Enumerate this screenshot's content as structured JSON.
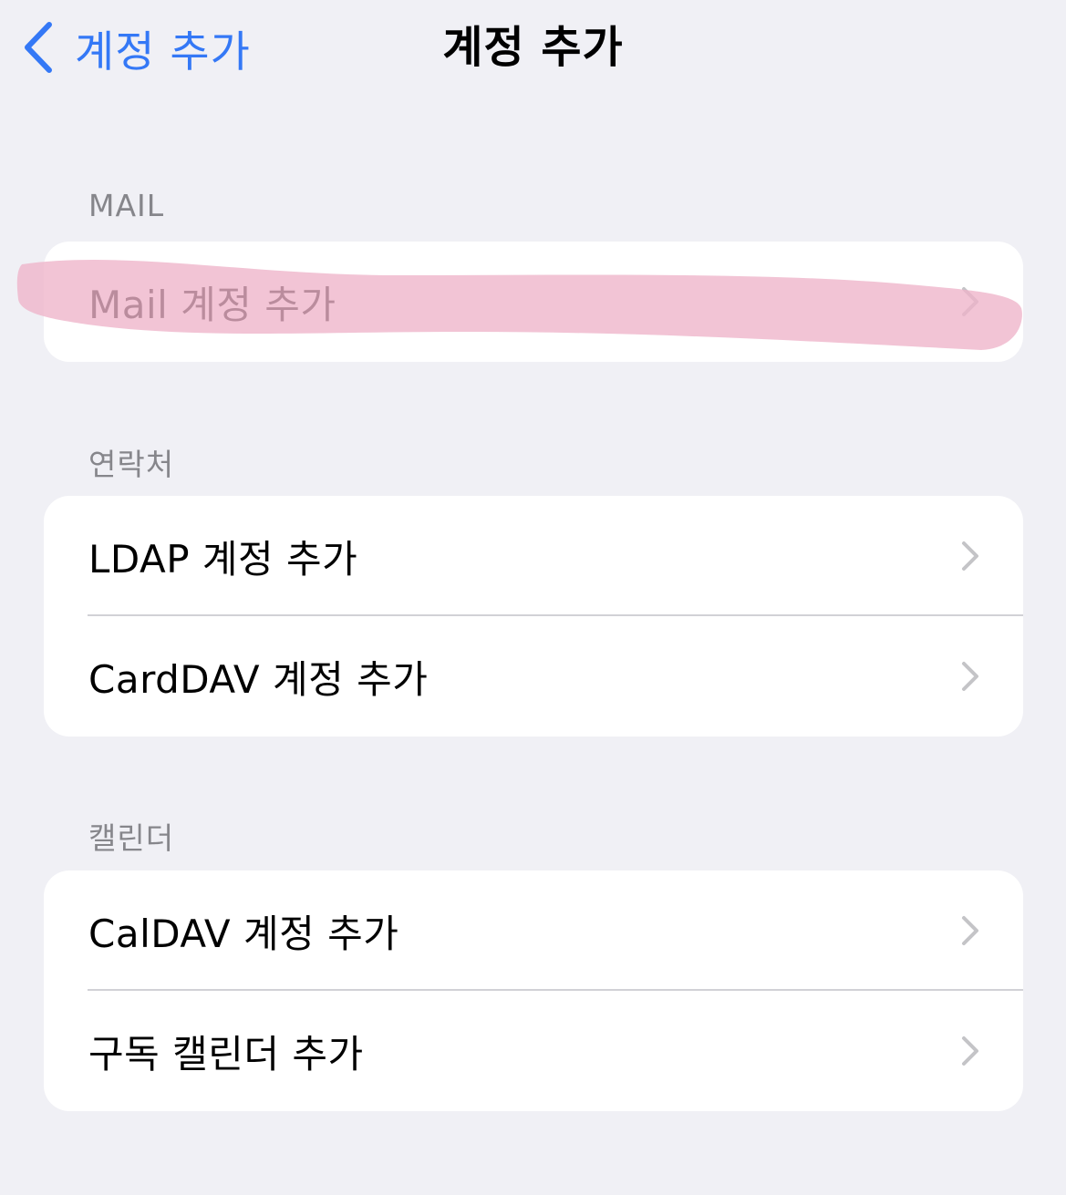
{
  "nav": {
    "back_label": "계정 추가",
    "title": "계정 추가"
  },
  "sections": [
    {
      "header": "MAIL",
      "rows": [
        {
          "label": "Mail 계정 추가"
        }
      ]
    },
    {
      "header": "연락처",
      "rows": [
        {
          "label": "LDAP 계정 추가"
        },
        {
          "label": "CardDAV 계정 추가"
        }
      ]
    },
    {
      "header": "캘린더",
      "rows": [
        {
          "label": "CalDAV 계정 추가"
        },
        {
          "label": "구독 캘린더 추가"
        }
      ]
    }
  ],
  "colors": {
    "background": "#f0f0f5",
    "accent": "#3478f6",
    "highlight": "#f2bfd2",
    "section_header": "#86868b",
    "chevron": "#c4c4c7"
  },
  "icons": {
    "back": "chevron-left-icon",
    "row_disclosure": "chevron-right-icon"
  }
}
